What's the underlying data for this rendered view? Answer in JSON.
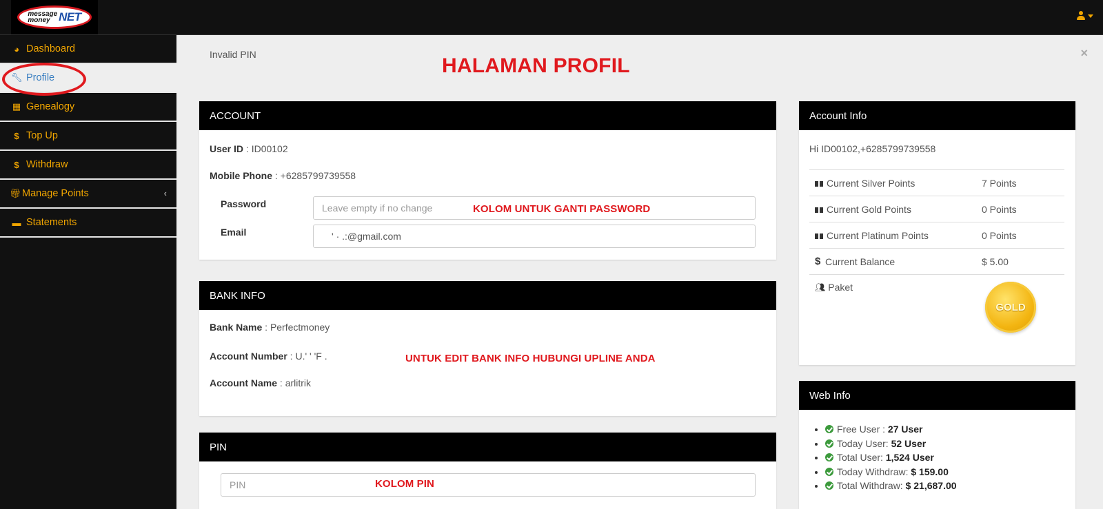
{
  "brand": {
    "line1": "message",
    "line2": "money",
    "net": "NET"
  },
  "sidebar": {
    "items": [
      {
        "label": "Dashboard",
        "icon": "dashboard-icon"
      },
      {
        "label": "Profile",
        "icon": "wrench-icon",
        "active": true
      },
      {
        "label": "Genealogy",
        "icon": "table-icon"
      },
      {
        "label": "Top Up",
        "icon": "dollar-icon"
      },
      {
        "label": "Withdraw",
        "icon": "dollar-icon"
      },
      {
        "label": "Manage Points",
        "icon": "gift-icon"
      },
      {
        "label": "Statements",
        "icon": "book-icon"
      }
    ],
    "chevron": "‹"
  },
  "alert": {
    "text": "Invalid PIN",
    "close": "×"
  },
  "heading": "HALAMAN PROFIL",
  "account": {
    "title": "ACCOUNT",
    "user_id_label": "User ID",
    "user_id": "ID00102",
    "mobile_label": "Mobile Phone",
    "mobile": "+6285799739558",
    "password_label": "Password",
    "password_placeholder": "Leave empty if no change",
    "password_note": "KOLOM UNTUK GANTI PASSWORD",
    "email_label": "Email",
    "email_value": "' ·  .:@gmail.com"
  },
  "bank": {
    "title": "BANK INFO",
    "bank_name_label": "Bank Name",
    "bank_name": "Perfectmoney",
    "account_number_label": "Account Number",
    "account_number": "U.' ' 'F .",
    "account_name_label": "Account Name",
    "account_name": "arlitrik",
    "note": "UNTUK EDIT BANK INFO HUBUNGI UPLINE ANDA"
  },
  "pin": {
    "title": "PIN",
    "placeholder": "PIN",
    "note": "KOLOM PIN"
  },
  "account_info": {
    "title": "Account Info",
    "greeting": "Hi ID00102,+6285799739558",
    "rows": [
      {
        "label": "Current Silver Points",
        "value": "7 Points"
      },
      {
        "label": "Current Gold Points",
        "value": "0 Points"
      },
      {
        "label": "Current Platinum Points",
        "value": "0 Points"
      },
      {
        "label": "Current Balance",
        "value": "$ 5.00"
      }
    ],
    "paket_label": "Paket",
    "badge_text": "GOLD"
  },
  "web_info": {
    "title": "Web Info",
    "items": [
      {
        "label": "Free User :",
        "value": "27 User"
      },
      {
        "label": "Today User:",
        "value": "52 User"
      },
      {
        "label": "Total User:",
        "value": "1,524 User"
      },
      {
        "label": "Today Withdraw:",
        "value": "$ 159.00"
      },
      {
        "label": "Total Withdraw:",
        "value": "$ 21,687.00"
      }
    ]
  },
  "colors": {
    "accent": "#f0a500",
    "annotation_red": "#e0191e",
    "link_blue": "#3a7fc1"
  }
}
